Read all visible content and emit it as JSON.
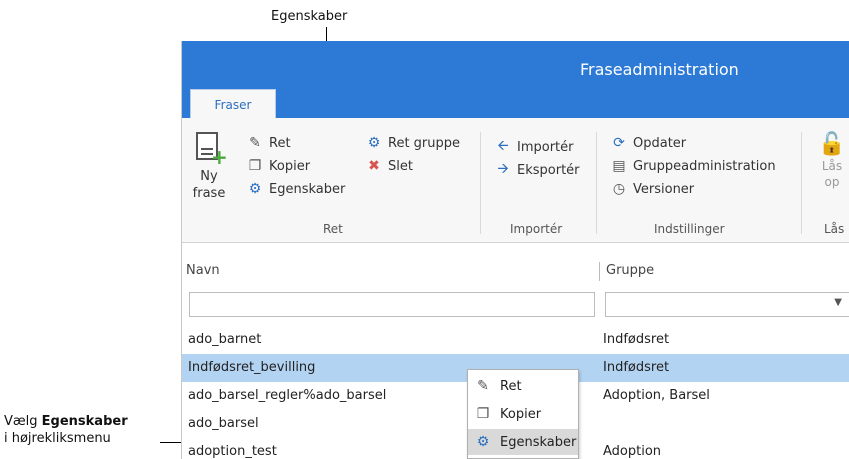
{
  "callouts": {
    "top": "Egenskaber",
    "left_prefix": "Vælg ",
    "left_bold": "Egenskaber",
    "left_line2": "i højrekliksmenu"
  },
  "window": {
    "title": "Fraseadministration",
    "tab": "Fraser"
  },
  "ribbon": {
    "new_phrase_line1": "Ny",
    "new_phrase_line2": "frase",
    "edit": "Ret",
    "copy": "Kopier",
    "properties": "Egenskaber",
    "edit_group": "Ret gruppe",
    "delete": "Slet",
    "group_edit": "Ret",
    "import": "Importér",
    "export": "Eksportér",
    "group_import": "Importér",
    "refresh": "Opdater",
    "group_admin": "Gruppeadministration",
    "versions": "Versioner",
    "group_settings": "Indstillinger",
    "unlock_line1": "Lås",
    "unlock_line2": "op",
    "group_lock": "Lås"
  },
  "grid": {
    "col_name": "Navn",
    "col_group": "Gruppe",
    "rows": [
      {
        "name": "ado_barnet",
        "group": "Indfødsret"
      },
      {
        "name": "Indfødsret_bevilling",
        "group": "Indfødsret"
      },
      {
        "name": "ado_barsel_regler%ado_barsel",
        "group": "Adoption, Barsel"
      },
      {
        "name": "ado_barsel",
        "group": ""
      },
      {
        "name": "adoption_test",
        "group": "Adoption"
      }
    ]
  },
  "context_menu": {
    "edit": "Ret",
    "copy": "Kopier",
    "properties": "Egenskaber"
  },
  "colors": {
    "titlebar": "#2d7ad6",
    "selected_row": "#b3d3f2",
    "delete_icon": "#d9534f",
    "add_icon": "#4caa3a"
  }
}
